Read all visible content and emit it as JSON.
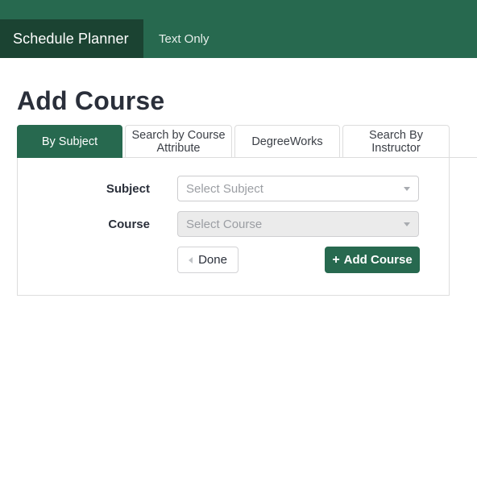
{
  "header": {
    "brand": "Schedule Planner",
    "text_only_link": "Text Only",
    "bar_color": "#27694F",
    "brand_tab_color": "#1B4332"
  },
  "page": {
    "title": "Add Course"
  },
  "tabs": [
    {
      "label": "By Subject",
      "active": true
    },
    {
      "label": "Search by Course Attribute",
      "active": false
    },
    {
      "label": "DegreeWorks",
      "active": false
    },
    {
      "label": "Search By Instructor",
      "active": false
    }
  ],
  "form": {
    "subject": {
      "label": "Subject",
      "value": "",
      "placeholder": "Select Subject",
      "disabled": false,
      "caret_icon": "chevron-down-icon"
    },
    "course": {
      "label": "Course",
      "value": "",
      "placeholder": "Select Course",
      "disabled": true,
      "caret_icon": "chevron-down-icon"
    }
  },
  "buttons": {
    "done": {
      "label": "Done",
      "icon": "chevron-left-icon"
    },
    "add_course": {
      "label": "Add Course",
      "icon": "plus-icon",
      "color": "#27694F"
    }
  }
}
